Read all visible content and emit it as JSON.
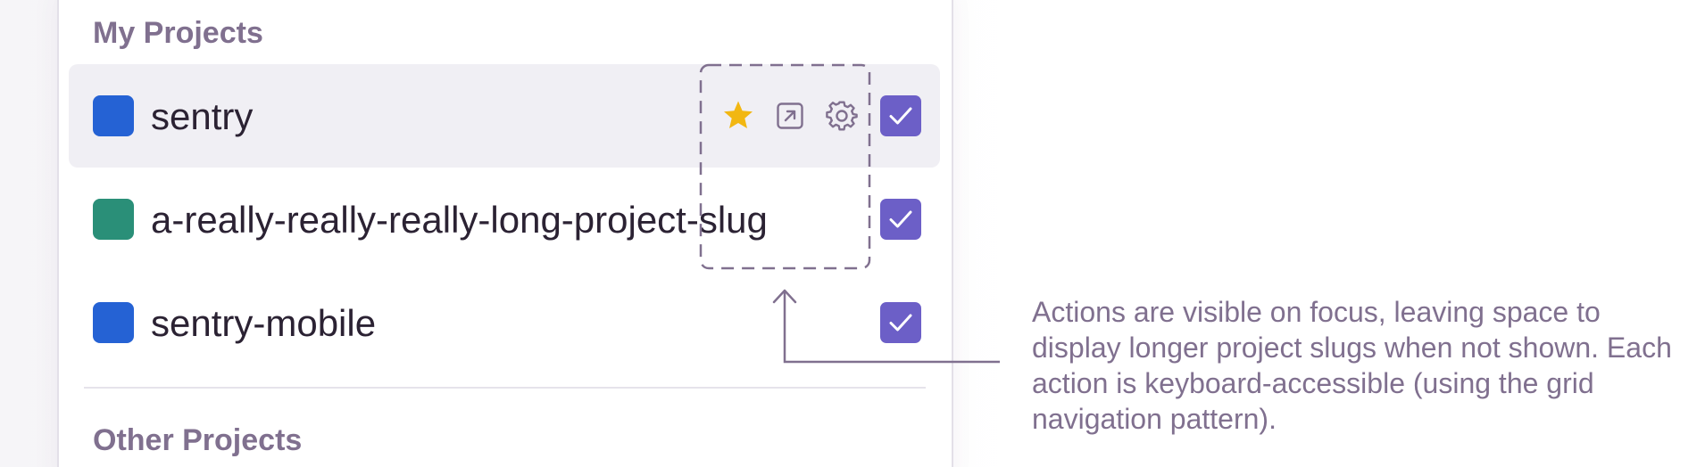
{
  "sections": {
    "mine_heading": "My Projects",
    "other_heading": "Other Projects"
  },
  "projects": [
    {
      "name": "sentry",
      "badge_color": "#2562d4",
      "selected": true,
      "focused": true
    },
    {
      "name": "a-really-really-really-long-project-slug",
      "badge_color": "#2a8f78",
      "selected": true,
      "focused": false
    },
    {
      "name": "sentry-mobile",
      "badge_color": "#2562d4",
      "selected": true,
      "focused": false
    }
  ],
  "actions": {
    "star_icon": "star-icon",
    "open_icon": "arrow-up-right-box-icon",
    "settings_icon": "gear-icon",
    "star_color": "#f2b712"
  },
  "colors": {
    "accent": "#6c5fc7",
    "heading": "#80708f",
    "focus_row_bg": "#f0eff4",
    "annotation": "#80708f"
  },
  "annotation": {
    "text": "Actions are visible on focus, leaving space to display longer project slugs when not shown. Each action is keyboard-accessible (using the grid navigation pattern)."
  }
}
